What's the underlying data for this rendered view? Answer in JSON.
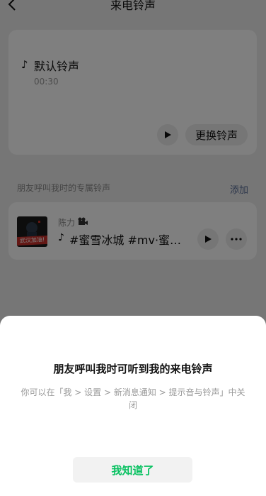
{
  "nav": {
    "title": "来电铃声"
  },
  "current_ringtone": {
    "name": "默认铃声",
    "duration": "00:30",
    "change_label": "更换铃声"
  },
  "friends_section": {
    "label": "朋友呼叫我时的专属铃声",
    "add_label": "添加"
  },
  "song": {
    "artist": "陈力",
    "title": "#蜜雪冰城 #mv·蜜雪冰城甜蜜蜜",
    "cover_sticker": "武汉加油!"
  },
  "sheet": {
    "title": "朋友呼叫我时可听到我的来电铃声",
    "description": "你可以在「我 > 设置 > 新消息通知 > 提示音与铃声」中关闭",
    "confirm_label": "我知道了"
  },
  "colors": {
    "accent": "#07c160",
    "link": "#576b95"
  }
}
